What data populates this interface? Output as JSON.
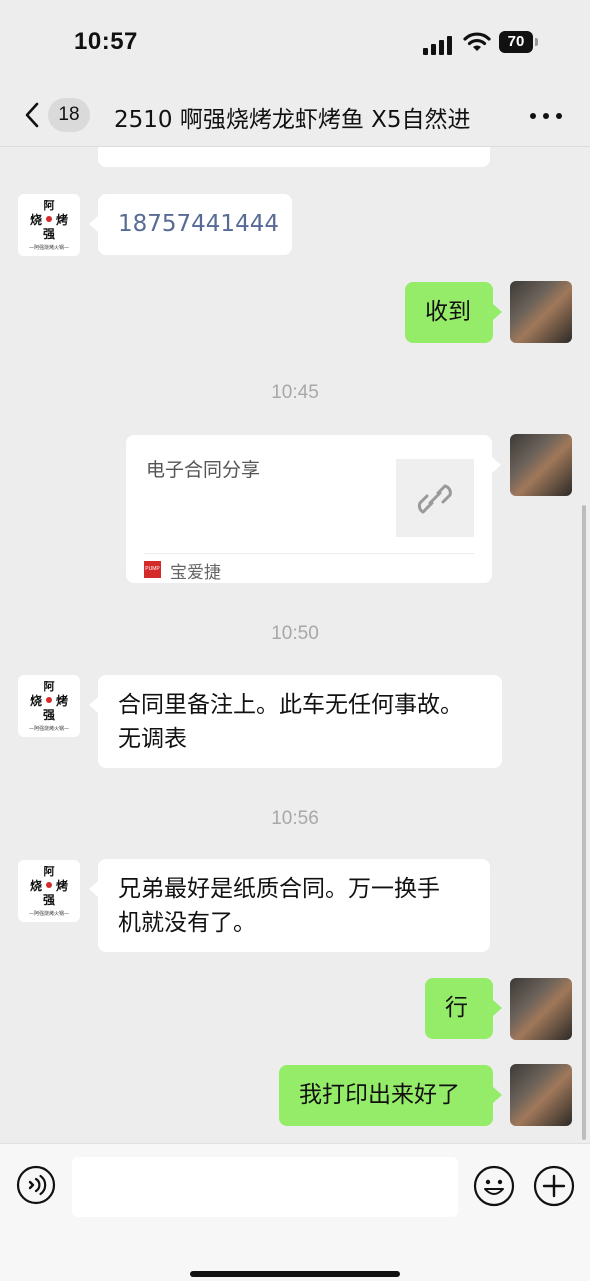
{
  "status_bar": {
    "time": "10:57",
    "battery": "70"
  },
  "nav": {
    "unread_count": "18",
    "title": "2510 啊强烧烤龙虾烤鱼 X5自然进"
  },
  "messages": [
    {
      "type": "text",
      "from": "other",
      "text": "18757441444"
    },
    {
      "type": "text",
      "from": "self",
      "text": "收到"
    },
    {
      "type": "time",
      "text": "10:45"
    },
    {
      "type": "link_card",
      "from": "self",
      "title": "电子合同分享",
      "source": "宝爱捷",
      "source_icon": "PUMP"
    },
    {
      "type": "time",
      "text": "10:50"
    },
    {
      "type": "text",
      "from": "other",
      "lines": [
        "合同里备注上。此车无任何事故。",
        "无调表"
      ]
    },
    {
      "type": "time",
      "text": "10:56"
    },
    {
      "type": "text",
      "from": "other",
      "lines": [
        "兄弟最好是纸质合同。万一换手",
        "机就没有了。"
      ]
    },
    {
      "type": "text",
      "from": "self",
      "text": "行"
    },
    {
      "type": "text",
      "from": "self",
      "text": "我打印出来好了"
    }
  ],
  "avatar_other": {
    "characters": [
      "阿",
      "烧",
      "烤",
      "强"
    ],
    "caption": "—阿强烧烤火锅—"
  },
  "input": {
    "placeholder": ""
  },
  "colors": {
    "bubble_self": "#95ec69",
    "bubble_other": "#ffffff",
    "background": "#ededed",
    "link": "#576b95"
  },
  "icons": [
    "signal-icon",
    "wifi-icon",
    "battery-icon",
    "back-chevron-icon",
    "more-icon",
    "link-icon",
    "voice-icon",
    "emoji-icon",
    "plus-icon"
  ]
}
